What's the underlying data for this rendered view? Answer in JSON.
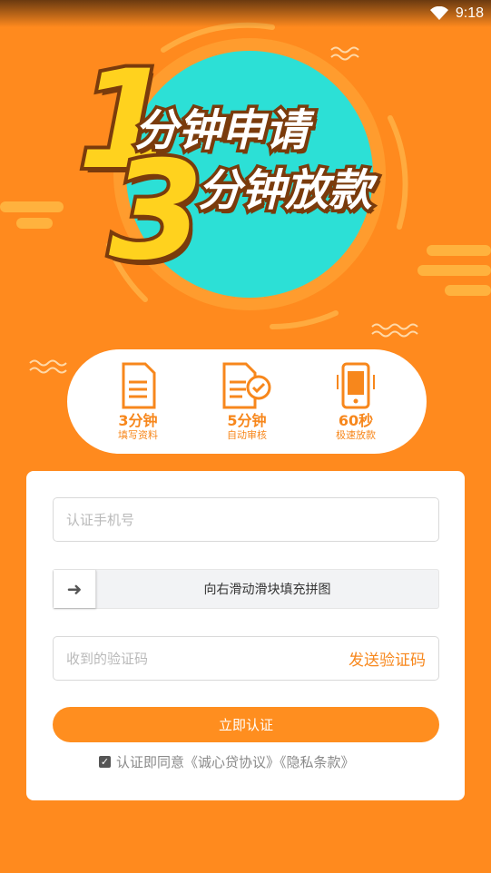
{
  "status_bar": {
    "time": "9:18",
    "icons": [
      "wifi-icon"
    ]
  },
  "banner": {
    "num1": "1",
    "slogan1": "分钟申请",
    "num3": "3",
    "slogan2": "分钟放款"
  },
  "steps": [
    {
      "icon": "form-icon",
      "title": "3分钟",
      "subtitle": "填写资料"
    },
    {
      "icon": "review-icon",
      "title": "5分钟",
      "subtitle": "自动审核"
    },
    {
      "icon": "phone-money-icon",
      "title": "60秒",
      "subtitle": "极速放款"
    }
  ],
  "form": {
    "phone_placeholder": "认证手机号",
    "slider_arrow": "➜",
    "slider_text": "向右滑动滑块填充拼图",
    "code_placeholder": "收到的验证码",
    "send_code_label": "发送验证码",
    "submit_label": "立即认证",
    "agreement_text": "认证即同意《诚心贷协议》《隐私条款》",
    "agreement_checked": true
  },
  "colors": {
    "primary": "#FF8A1E",
    "accent": "#F7871C",
    "teal": "#2CE0D6",
    "brown": "#7A3B0C"
  }
}
